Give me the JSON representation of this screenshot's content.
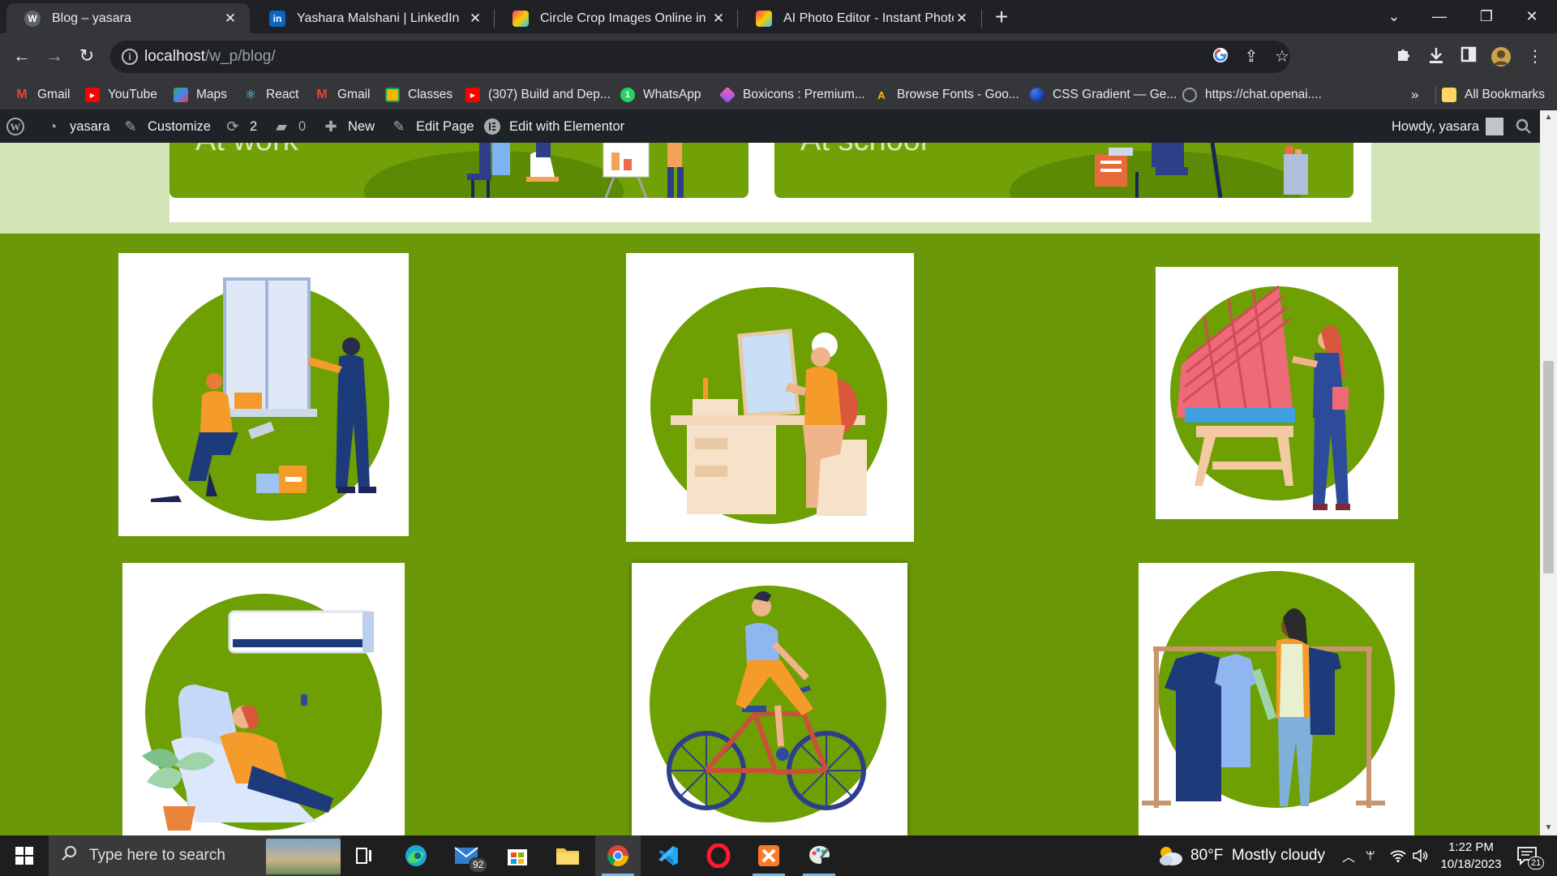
{
  "browser": {
    "tabs": [
      {
        "title": "Blog – yasara",
        "active": true,
        "favicon": "wordpress-icon"
      },
      {
        "title": "Yashara Malshani | LinkedIn",
        "active": false,
        "favicon": "linkedin-icon"
      },
      {
        "title": "Circle Crop Images Online in Sec",
        "active": false,
        "favicon": "colorful-square-icon"
      },
      {
        "title": "AI Photo Editor - Instant Photo E",
        "active": false,
        "favicon": "colorful-square-icon"
      }
    ],
    "url_host": "localhost",
    "url_path": "/w_p/blog/",
    "bookmarks": [
      {
        "label": "Gmail",
        "icon": "gmail-icon"
      },
      {
        "label": "YouTube",
        "icon": "youtube-icon"
      },
      {
        "label": "Maps",
        "icon": "maps-icon"
      },
      {
        "label": "React",
        "icon": "react-icon"
      },
      {
        "label": "Gmail",
        "icon": "gmail-icon"
      },
      {
        "label": "Classes",
        "icon": "classroom-icon"
      },
      {
        "label": "(307) Build and Dep...",
        "icon": "youtube-icon"
      },
      {
        "label": "WhatsApp",
        "icon": "whatsapp-icon"
      },
      {
        "label": "Boxicons : Premium...",
        "icon": "boxicons-icon"
      },
      {
        "label": "Browse Fonts - Goo...",
        "icon": "google-fonts-icon"
      },
      {
        "label": "CSS Gradient — Ge...",
        "icon": "css-gradient-icon"
      },
      {
        "label": "https://chat.openai....",
        "icon": "openai-icon"
      }
    ],
    "bookmarks_overflow": "»",
    "all_bookmarks": "All Bookmarks"
  },
  "wp_admin_bar": {
    "site_name": "yasara",
    "customize": "Customize",
    "updates_count": "2",
    "comments_count": "0",
    "new_label": "New",
    "edit_page": "Edit Page",
    "edit_elementor": "Edit with Elementor",
    "howdy": "Howdy, yasara"
  },
  "page": {
    "banners": [
      {
        "text": "At work"
      },
      {
        "text": "At school"
      }
    ],
    "tiles": [
      {
        "name": "tile-window-workers",
        "alt": "Workers installing a window"
      },
      {
        "name": "tile-woman-dressing-table",
        "alt": "Woman at dressing table"
      },
      {
        "name": "tile-woman-roof",
        "alt": "Woman inspecting roof tiles"
      },
      {
        "name": "tile-air-conditioner",
        "alt": "Woman relaxing under air conditioner"
      },
      {
        "name": "tile-cyclist",
        "alt": "Woman riding a bicycle"
      },
      {
        "name": "tile-clothes-rack",
        "alt": "Woman choosing clothes on rack"
      }
    ]
  },
  "taskbar": {
    "search_placeholder": "Type here to search",
    "mail_badge": "92",
    "weather": "80°F  Mostly cloudy",
    "time": "1:22 PM",
    "date": "10/18/2023",
    "notifications": "21"
  },
  "colors": {
    "page_green": "#6b9808",
    "circle_green": "#6ea004",
    "top_band": "#d3e4b6",
    "wp_bar": "#1d2327",
    "chrome_dark": "#202124",
    "chrome_toolbar": "#35363a"
  }
}
